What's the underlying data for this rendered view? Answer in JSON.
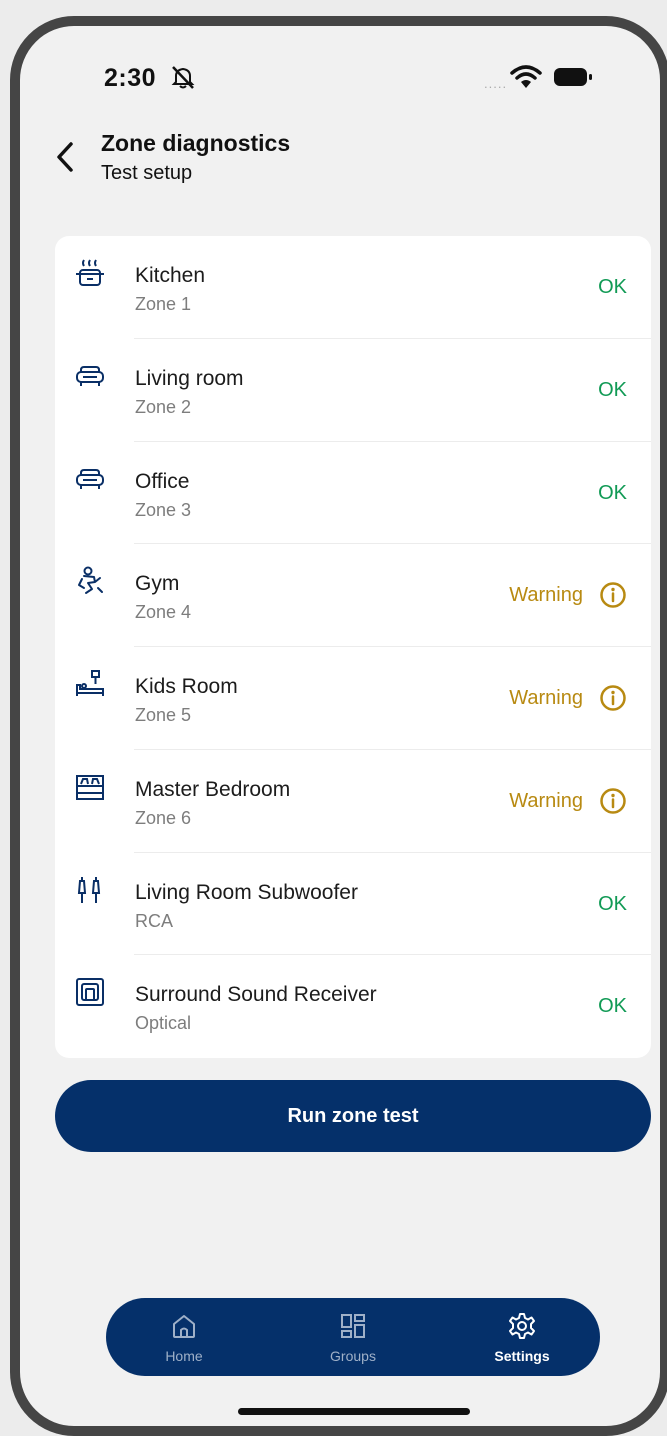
{
  "status_bar": {
    "time": "2:30",
    "signal": "....."
  },
  "header": {
    "title": "Zone diagnostics",
    "subtitle": "Test setup"
  },
  "zones": [
    {
      "name": "Kitchen",
      "zone": "Zone 1",
      "status": "OK",
      "icon": "cooking-pot-icon"
    },
    {
      "name": "Living room",
      "zone": "Zone 2",
      "status": "OK",
      "icon": "sofa-icon"
    },
    {
      "name": "Office",
      "zone": "Zone 3",
      "status": "OK",
      "icon": "sofa-icon"
    },
    {
      "name": "Gym",
      "zone": "Zone 4",
      "status": "Warning",
      "icon": "exercise-icon"
    },
    {
      "name": "Kids Room",
      "zone": "Zone 5",
      "status": "Warning",
      "icon": "kids-bed-icon"
    },
    {
      "name": "Master Bedroom",
      "zone": "Zone 6",
      "status": "Warning",
      "icon": "double-bed-icon"
    },
    {
      "name": "Living Room Subwoofer",
      "zone": "RCA",
      "status": "OK",
      "icon": "rca-plug-icon"
    },
    {
      "name": "Surround Sound Receiver",
      "zone": "Optical",
      "status": "OK",
      "icon": "optical-port-icon"
    }
  ],
  "actions": {
    "run_test": "Run zone test"
  },
  "tabs": [
    {
      "label": "Home",
      "icon": "home-icon"
    },
    {
      "label": "Groups",
      "icon": "groups-icon"
    },
    {
      "label": "Settings",
      "icon": "gear-icon"
    }
  ],
  "colors": {
    "accent": "#05306a",
    "ok": "#119a55",
    "warning": "#b88a12"
  }
}
